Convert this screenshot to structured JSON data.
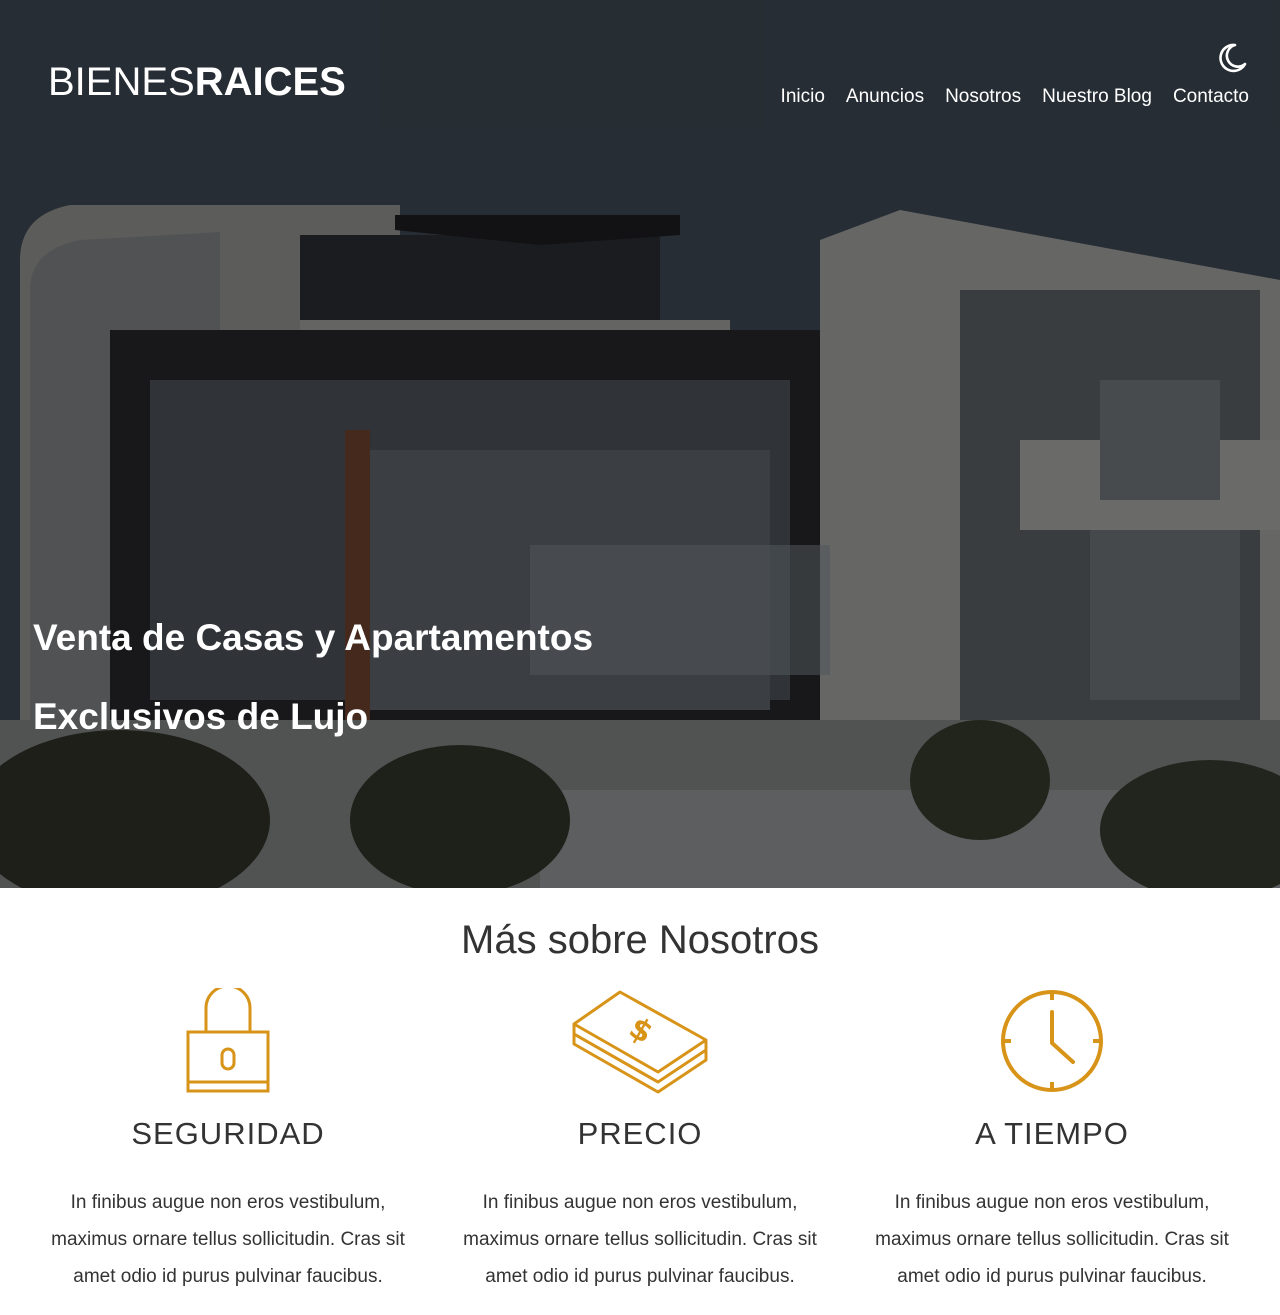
{
  "header": {
    "logo_light": "BIENES",
    "logo_bold": "RAICES",
    "theme_toggle_icon": "moon-icon",
    "nav": [
      {
        "label": "Inicio"
      },
      {
        "label": "Anuncios"
      },
      {
        "label": "Nosotros"
      },
      {
        "label": "Nuestro Blog"
      },
      {
        "label": "Contacto"
      }
    ]
  },
  "hero": {
    "title": "Venta de Casas y Apartamentos Exclusivos de Lujo"
  },
  "about": {
    "title": "Más sobre Nosotros",
    "features": [
      {
        "icon": "lock-icon",
        "heading": "SEGURIDAD",
        "text": "In finibus augue non eros vestibulum, maximus ornare tellus sollicitudin. Cras sit amet odio id purus pulvinar faucibus."
      },
      {
        "icon": "money-stack-icon",
        "heading": "PRECIO",
        "text": "In finibus augue non eros vestibulum, maximus ornare tellus sollicitudin. Cras sit amet odio id purus pulvinar faucibus."
      },
      {
        "icon": "clock-icon",
        "heading": "A TIEMPO",
        "text": "In finibus augue non eros vestibulum, maximus ornare tellus sollicitudin. Cras sit amet odio id purus pulvinar faucibus."
      }
    ]
  },
  "colors": {
    "accent": "#d89418",
    "text": "#333333",
    "white": "#ffffff"
  }
}
